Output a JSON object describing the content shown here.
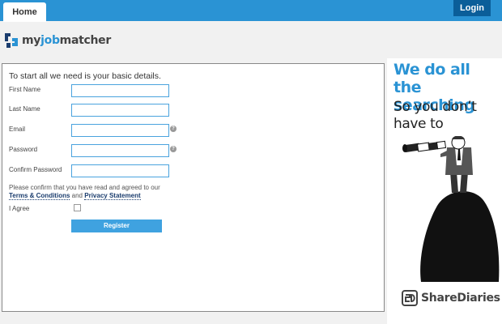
{
  "nav": {
    "home_label": "Home",
    "login_label": "Login"
  },
  "logo": {
    "prefix": "my",
    "accent": "job",
    "suffix": "matcher"
  },
  "form": {
    "intro": "To start all we need is your basic details.",
    "fields": [
      {
        "label": "First Name",
        "value": ""
      },
      {
        "label": "Last Name",
        "value": ""
      },
      {
        "label": "Email",
        "value": ""
      },
      {
        "label": "Password",
        "value": ""
      },
      {
        "label": "Confirm Password",
        "value": ""
      }
    ],
    "help_glyph": "?",
    "confirm_text": "Please confirm that you have read and agreed to our",
    "terms_link": "Terms & Conditions",
    "and_text": "and",
    "privacy_link": "Privacy Statement",
    "agree_label": "I Agree",
    "agree_checked": false,
    "register_label": "Register"
  },
  "promo": {
    "headline": "We do all the searching",
    "subline": "So you don’t have to",
    "brand": "ShareDiaries"
  },
  "colors": {
    "accent": "#2a93d4",
    "login_bg": "#0b5e99",
    "button": "#3fa2e0"
  },
  "icons": [
    "logo-mark-icon",
    "help-icon",
    "telescope-man-illustration",
    "sharediaries-logo-icon"
  ]
}
